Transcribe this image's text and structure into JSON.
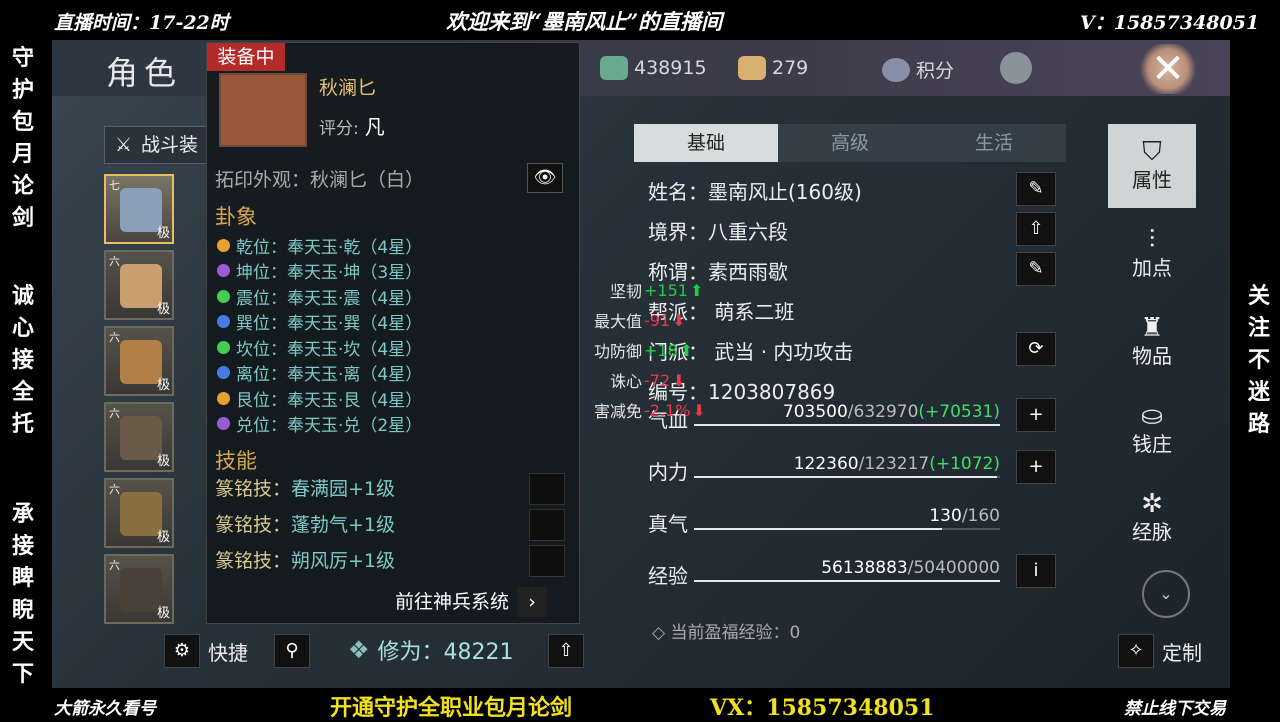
{
  "overlay": {
    "top_left": "直播时间：17-22时",
    "top_center": "欢迎来到“墨南风止”的直播间",
    "top_right": "V：15857348051",
    "left_col1": "守护包月论剑",
    "left_col2": "诚心接全托",
    "left_col3": "承接睥睨天下",
    "right_col1": "关注不迷路",
    "bottom_left": "大箭永久看号",
    "bottom_center": "开通守护全职业包月论剑",
    "bottom_vx": "VX：15857348051",
    "bottom_right": "禁止线下交易"
  },
  "header": {
    "title": "角色",
    "currency1": "438915",
    "currency2": "279",
    "points_label": "积分",
    "close": "✕"
  },
  "combat_tab": "战斗装",
  "slots": [
    {
      "lv": "七",
      "q": "极"
    },
    {
      "lv": "六",
      "q": "极"
    },
    {
      "lv": "六",
      "q": "极"
    },
    {
      "lv": "六",
      "q": "极"
    },
    {
      "lv": "六",
      "q": "极"
    },
    {
      "lv": "六",
      "q": "极"
    }
  ],
  "popup": {
    "equipped_tag": "装备中",
    "item_name": "秋澜匕",
    "rating_label": "评分:",
    "rating_value": "凡",
    "skin": "拓印外观：秋澜匕（白）",
    "eye": "👁",
    "gua_title": "卦象",
    "gua": [
      {
        "text": "乾位：奉天玉·乾（4星）",
        "color": "#e8a030"
      },
      {
        "text": "坤位：奉天玉·坤（3星）",
        "color": "#9b5ad8"
      },
      {
        "text": "震位：奉天玉·震（4星）",
        "color": "#44cc55"
      },
      {
        "text": "巽位：奉天玉·巽（4星）",
        "color": "#4a7ae8"
      },
      {
        "text": "坎位：奉天玉·坎（4星）",
        "color": "#44cc55"
      },
      {
        "text": "离位：奉天玉·离（4星）",
        "color": "#4a7ae8"
      },
      {
        "text": "艮位：奉天玉·艮（4星）",
        "color": "#e8a030"
      },
      {
        "text": "兑位：奉天玉·兑（2星）",
        "color": "#9b5ad8"
      }
    ],
    "skill_title": "技能",
    "skills": [
      {
        "k": "篆铭技：",
        "v": "春满园+1级"
      },
      {
        "k": "篆铭技：",
        "v": "蓬勃气+1级"
      },
      {
        "k": "篆铭技：",
        "v": "朔风厉+1级"
      }
    ],
    "goto": "前往神兵系统",
    "goto_arrow": "›"
  },
  "bonus": [
    {
      "k": "坚韧",
      "v": "+151",
      "dir": "up"
    },
    {
      "k": "最大值",
      "v": "-91",
      "dir": "dn"
    },
    {
      "k": "功防御",
      "v": "+18",
      "dir": "up"
    },
    {
      "k": "诛心",
      "v": "-72",
      "dir": "dn"
    },
    {
      "k": "害减免",
      "v": "-2.1%",
      "dir": "dn"
    }
  ],
  "tabs": [
    "基础",
    "高级",
    "生活"
  ],
  "info": [
    {
      "text": "姓名：墨南风止(160级)",
      "btn": "✎"
    },
    {
      "text": "境界：八重六段",
      "btn": "⇧"
    },
    {
      "text": "称谓：素西雨歇",
      "btn": "✎"
    },
    {
      "text": "帮派：  萌系二班",
      "btn": ""
    },
    {
      "text": "门派：  武当 · 内功攻击",
      "btn": "⟳"
    },
    {
      "text": "编号：1203807869",
      "btn": ""
    }
  ],
  "bars": [
    {
      "label": "气血",
      "cur": "703500",
      "max": "/632970",
      "extra": "(+70531)",
      "fill": 1.0,
      "btn": "+"
    },
    {
      "label": "内力",
      "cur": "122360",
      "max": "/123217",
      "extra": "(+1072)",
      "fill": 0.99,
      "btn": "+"
    },
    {
      "label": "真气",
      "cur": "130",
      "max": "/160",
      "extra": "",
      "fill": 0.81,
      "btn": ""
    },
    {
      "label": "经验",
      "cur": "56138883",
      "max": "/50400000",
      "extra": "",
      "fill": 1.0,
      "btn": "i"
    }
  ],
  "blessing": "◇ 当前盈福经验：0",
  "side": [
    {
      "icon": "⛉",
      "label": "属性"
    },
    {
      "icon": "⫶",
      "label": "加点"
    },
    {
      "icon": "♜",
      "label": "物品"
    },
    {
      "icon": "⛀",
      "label": "钱庄"
    },
    {
      "icon": "✲",
      "label": "经脉"
    }
  ],
  "bottom": {
    "shortcut": "快捷",
    "cultivation": "修为：48221",
    "customize": "定制"
  }
}
